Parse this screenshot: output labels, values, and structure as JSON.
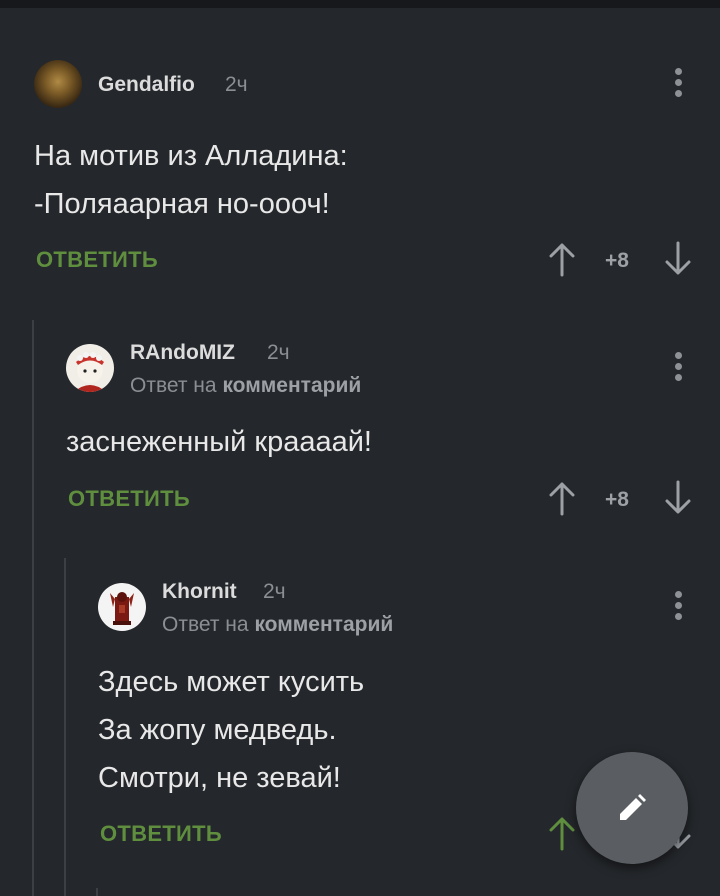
{
  "comments": [
    {
      "author": "Gendalfio",
      "time": "2ч",
      "lines": [
        "На мотив из Алладина:",
        "-Поляаарная но-оооч!"
      ],
      "reply_label": "ОТВЕТИТЬ",
      "score": "+8"
    },
    {
      "author": "RAndoMIZ",
      "time": "2ч",
      "reply_prefix": "Ответ на",
      "reply_target": "комментарий",
      "lines": [
        "заснеженный краааай!"
      ],
      "reply_label": "ОТВЕТИТЬ",
      "score": "+8"
    },
    {
      "author": "Khornit",
      "time": "2ч",
      "reply_prefix": "Ответ на",
      "reply_target": "комментарий",
      "lines": [
        "Здесь может кусить",
        "За жопу медведь.",
        "Смотри, не зевай!"
      ],
      "reply_label": "ОТВЕТИТЬ"
    }
  ],
  "colors": {
    "background": "#24272b",
    "accent_green": "#5e8e3e",
    "muted": "#8b8f94"
  },
  "icons": [
    "kebab-icon",
    "arrow-up-icon",
    "arrow-down-icon",
    "pencil-icon"
  ]
}
